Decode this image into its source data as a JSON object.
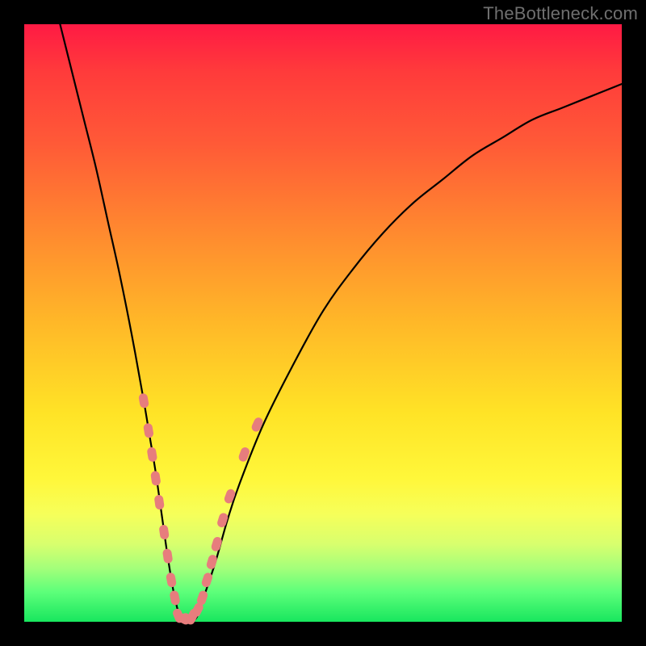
{
  "watermark": "TheBottleneck.com",
  "chart_data": {
    "type": "line",
    "title": "",
    "xlabel": "",
    "ylabel": "",
    "xlim": [
      0,
      100
    ],
    "ylim": [
      0,
      100
    ],
    "grid": false,
    "legend": false,
    "series": [
      {
        "name": "curve",
        "x": [
          6,
          8,
          10,
          12,
          14,
          16,
          18,
          20,
          21,
          22,
          23,
          24,
          25,
          26,
          27,
          28,
          29,
          30,
          32,
          34,
          36,
          40,
          45,
          50,
          55,
          60,
          65,
          70,
          75,
          80,
          85,
          90,
          95,
          100
        ],
        "y": [
          100,
          92,
          84,
          76,
          67,
          58,
          48,
          37,
          31,
          25,
          18,
          11,
          5,
          1,
          0,
          0,
          1,
          4,
          10,
          17,
          23,
          33,
          43,
          52,
          59,
          65,
          70,
          74,
          78,
          81,
          84,
          86,
          88,
          90
        ]
      }
    ],
    "marker_clusters": [
      {
        "note": "left descending arm",
        "points": [
          {
            "x": 20.0,
            "y": 37
          },
          {
            "x": 20.8,
            "y": 32
          },
          {
            "x": 21.4,
            "y": 28
          },
          {
            "x": 22.0,
            "y": 24
          },
          {
            "x": 22.6,
            "y": 20
          },
          {
            "x": 23.4,
            "y": 15
          },
          {
            "x": 24.0,
            "y": 11
          },
          {
            "x": 24.6,
            "y": 7
          },
          {
            "x": 25.2,
            "y": 4
          }
        ]
      },
      {
        "note": "valley bottom pills",
        "points": [
          {
            "x": 25.8,
            "y": 1
          },
          {
            "x": 26.6,
            "y": 0.5
          },
          {
            "x": 27.4,
            "y": 0.5
          },
          {
            "x": 28.2,
            "y": 1
          },
          {
            "x": 29.0,
            "y": 2
          }
        ]
      },
      {
        "note": "right ascending arm",
        "points": [
          {
            "x": 29.8,
            "y": 4
          },
          {
            "x": 30.6,
            "y": 7
          },
          {
            "x": 31.4,
            "y": 10
          },
          {
            "x": 32.2,
            "y": 13
          },
          {
            "x": 33.2,
            "y": 17
          },
          {
            "x": 34.4,
            "y": 21
          },
          {
            "x": 36.8,
            "y": 28
          },
          {
            "x": 39.0,
            "y": 33
          }
        ]
      }
    ],
    "colors": {
      "curve_stroke": "#000000",
      "marker_fill": "#e77d7d"
    }
  }
}
